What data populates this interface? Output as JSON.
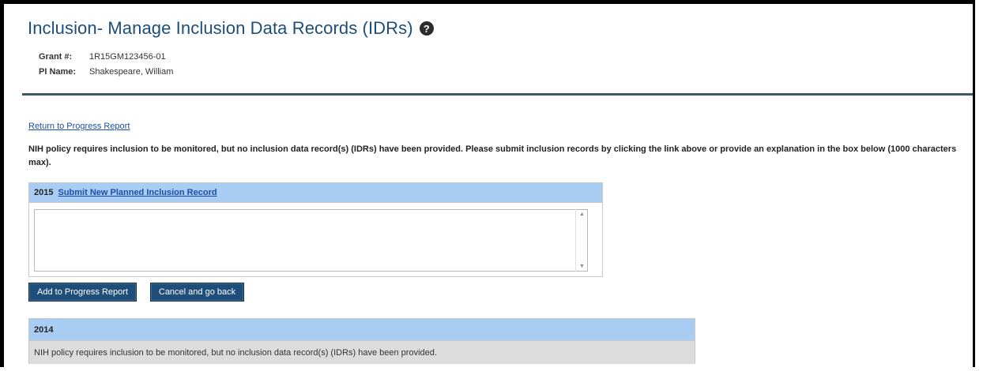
{
  "header": {
    "title": "Inclusion- Manage Inclusion Data Records (IDRs)",
    "help_icon_glyph": "?"
  },
  "info": {
    "grant_label": "Grant #:",
    "grant_value": "1R15GM123456-01",
    "pi_label": "PI Name:",
    "pi_value": "Shakespeare, William"
  },
  "links": {
    "return_label": "Return to Progress Report"
  },
  "policy_message": "NIH policy requires inclusion to be monitored, but no inclusion data record(s) (IDRs) have been provided. Please submit inclusion records by clicking the link above or provide an explanation in the box below (1000 characters max).",
  "panel_2015": {
    "year": "2015",
    "submit_link": "Submit New Planned Inclusion Record",
    "explanation_value": ""
  },
  "buttons": {
    "add_label": "Add to Progress Report",
    "cancel_label": "Cancel and go back"
  },
  "panel_2014": {
    "year": "2014",
    "message": "NIH policy requires inclusion to be monitored, but no inclusion data record(s) (IDRs) have been provided."
  },
  "colors": {
    "title": "#1c4e79",
    "panel_header": "#a9cdf2",
    "button": "#1f4e7a",
    "link": "#1a4fa8",
    "rule": "#3d5a63"
  }
}
